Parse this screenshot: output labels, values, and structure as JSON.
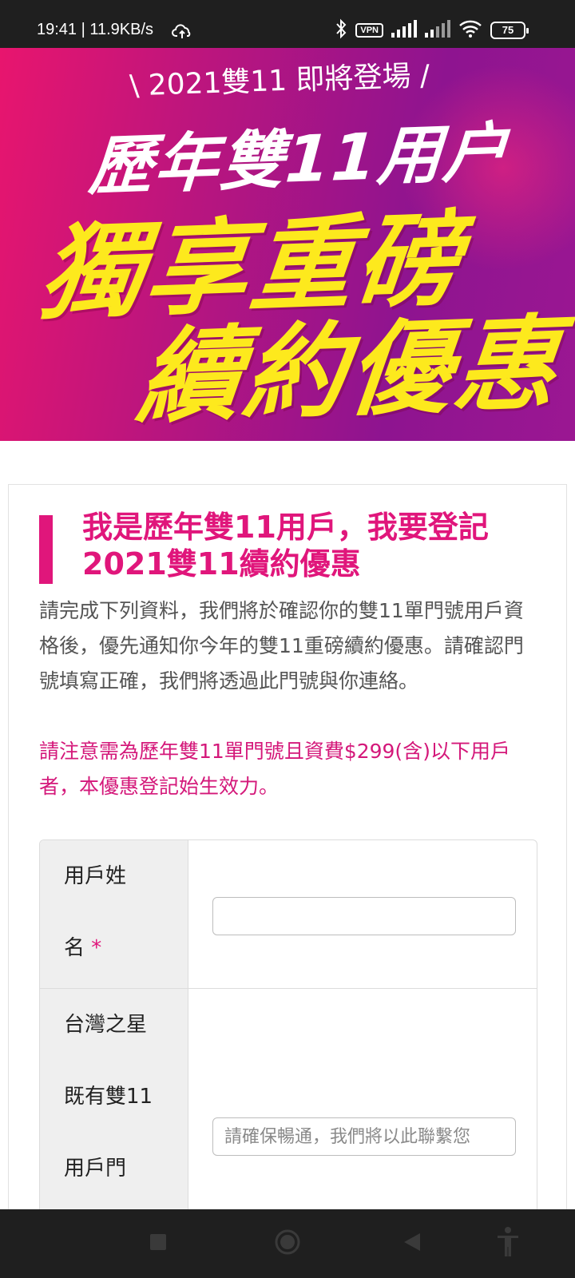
{
  "status_bar": {
    "time_speed": "19:41 | 11.9KB/s",
    "vpn": "VPN",
    "battery": "75"
  },
  "banner": {
    "subtitle": "\\ 2021雙11 即將登場 /",
    "title": "歷年雙11用户",
    "headline_1": "獨享重磅",
    "headline_2": "續約優惠"
  },
  "card": {
    "heading": "我是歷年雙11用戶，我要登記2021雙11續約優惠",
    "description": "請完成下列資料，我們將於確認你的雙11單門號用戶資格後，優先通知你今年的雙11重磅續約優惠。請確認門號填寫正確，我們將透過此門號與你連絡。",
    "notice": "請注意需為歷年雙11單門號且資費$299(含)以下用戶者，本優惠登記始生效力。"
  },
  "form": {
    "name_label_line1": "用戶姓",
    "name_label_line2": "名",
    "required_mark": "*",
    "name_value": "",
    "phone_label_line1": "台灣之星",
    "phone_label_line2": "既有雙11",
    "phone_label_line3": "用戶門",
    "phone_placeholder": "請確保暢通，我們將以此聯繫您"
  },
  "colors": {
    "accent": "#e0167b",
    "banner_yellow": "#fde91d",
    "status_bar": "#1f1f1f"
  },
  "icons": [
    "cloud-upload-icon",
    "bluetooth-icon",
    "signal-icon",
    "wifi-icon",
    "battery-icon",
    "recents-icon",
    "home-icon",
    "back-icon",
    "accessibility-icon"
  ]
}
